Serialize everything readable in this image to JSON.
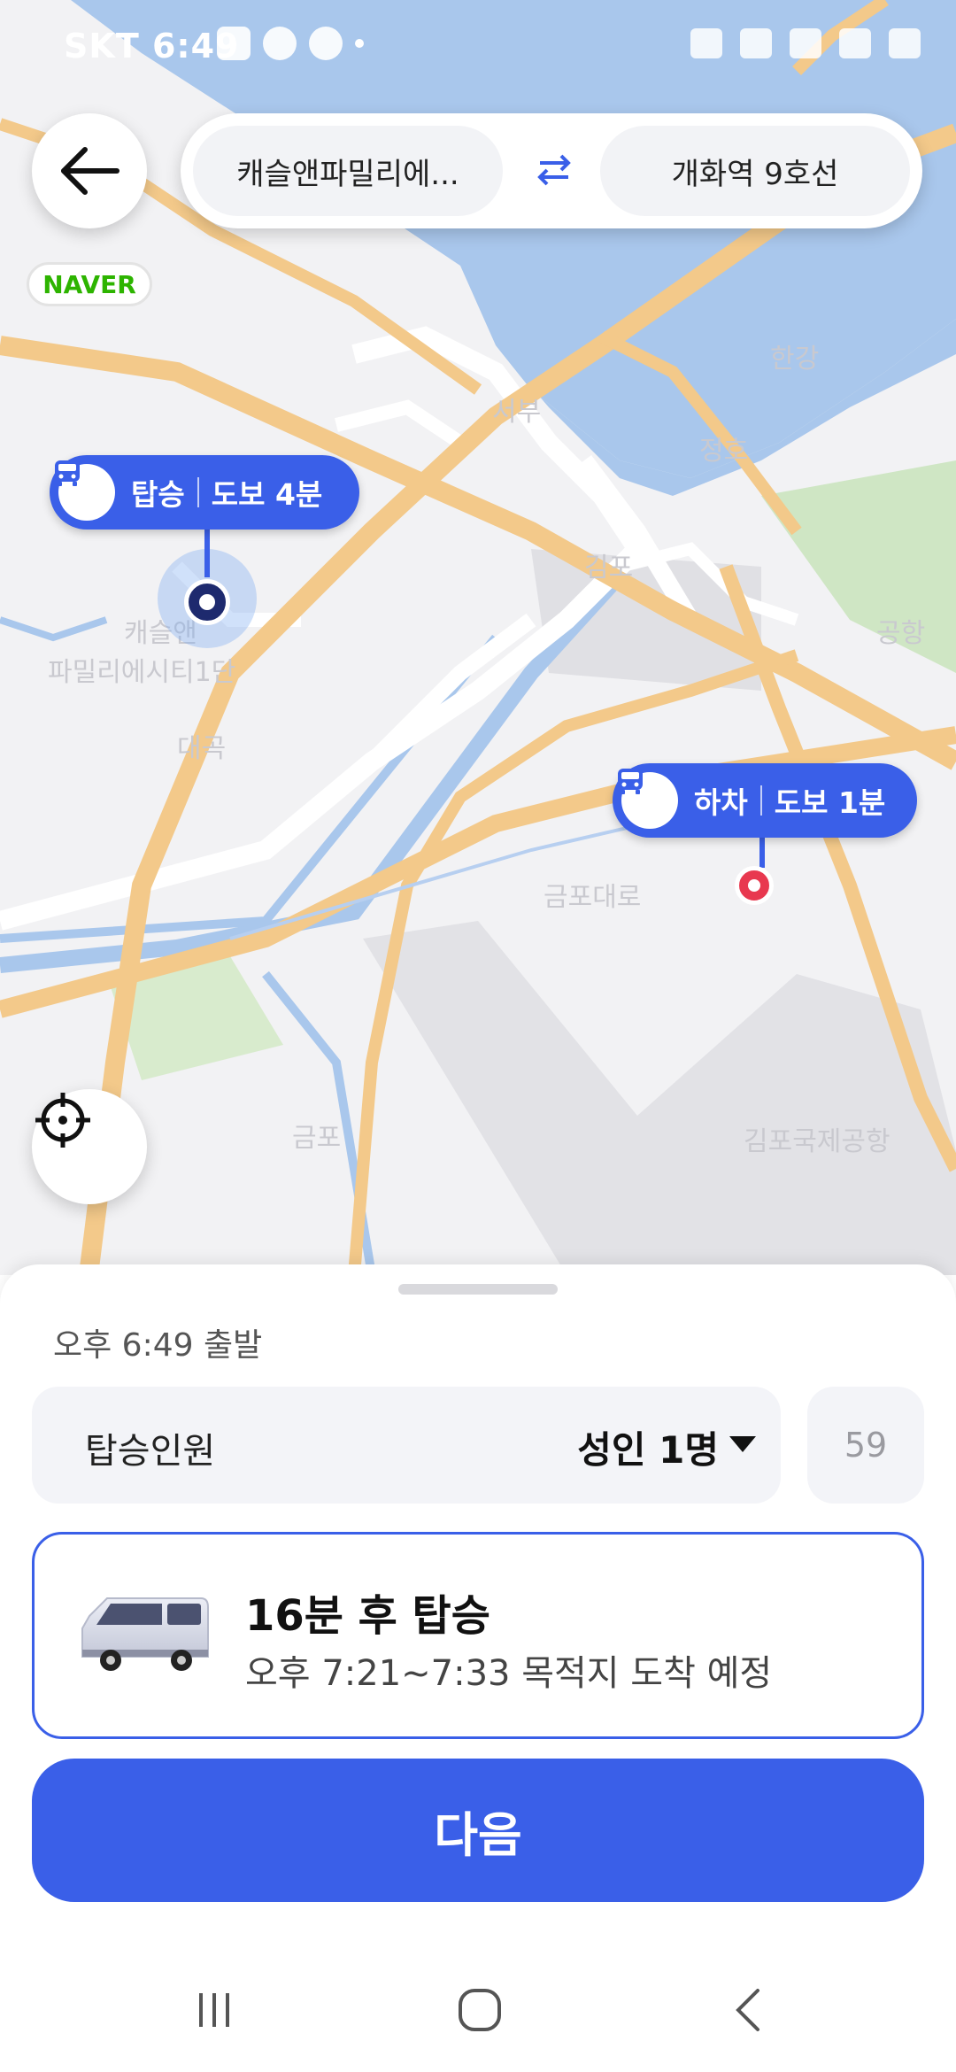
{
  "status_bar": {
    "carrier_time": "SKT 6:49"
  },
  "route": {
    "from": "캐슬앤파밀리에...",
    "to": "개화역 9호선"
  },
  "map": {
    "brand": "NAVER",
    "pickup": {
      "type": "탑승",
      "walk": "도보 4분"
    },
    "dropoff": {
      "type": "하차",
      "walk": "도보 1분"
    },
    "labels": [
      "캐슬앤",
      "파밀리에시티1단",
      "서부",
      "김포",
      "정호",
      "한강",
      "대곡",
      "금포",
      "공항",
      "김포국제공항",
      "금포대로"
    ]
  },
  "sheet": {
    "departure": "오후 6:49 출발",
    "passengers": {
      "label": "탑승인원",
      "value": "성인 1명"
    },
    "seat_count": "59",
    "ride": {
      "title": "16분 후 탑승",
      "eta": "오후 7:21~7:33 목적지 도착 예정"
    },
    "next_label": "다음"
  },
  "colors": {
    "accent": "#3a5fe8",
    "water": "#a9c7ec",
    "road": "#f3c98a",
    "dropoff_pin": "#e8384f"
  },
  "icons": [
    "back-arrow-icon",
    "swap-icon",
    "bus-icon",
    "locate-icon",
    "recent-apps-icon",
    "home-icon",
    "back-icon"
  ]
}
